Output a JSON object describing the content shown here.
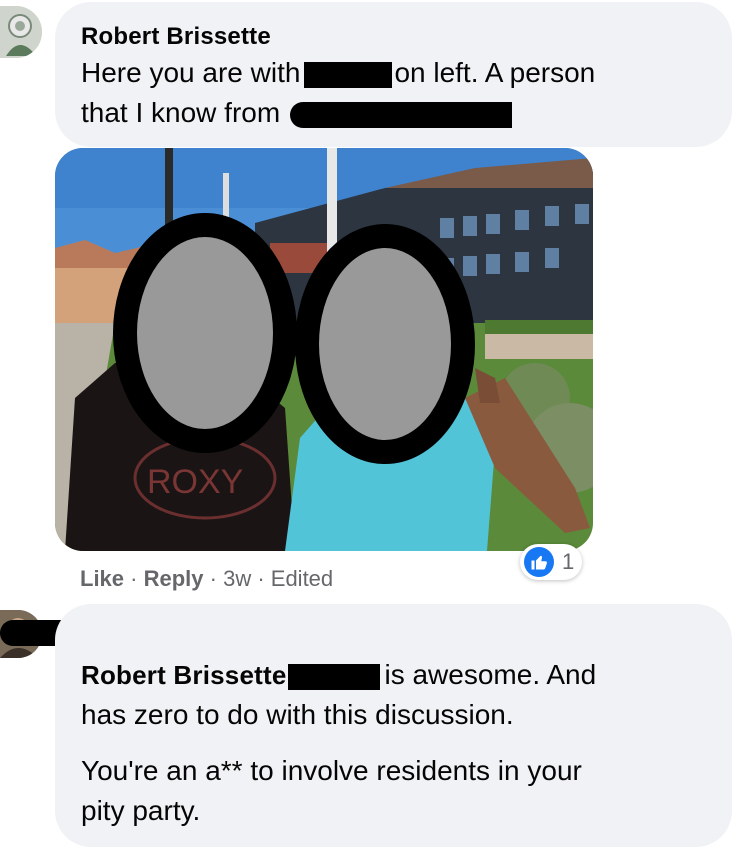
{
  "comment1": {
    "author": "Robert Brissette",
    "line1_before": "Here you are with",
    "line1_after": "on left. A person",
    "line2_before": "that I know from",
    "photo": {
      "shirt_text": "ROXY"
    },
    "actions": {
      "like": "Like",
      "sep1": " · ",
      "reply": "Reply",
      "sep2": " · ",
      "time": "3w",
      "sep3": " · ",
      "edited": "Edited"
    },
    "reaction_count": "1"
  },
  "comment2": {
    "author": "Robert Brissette",
    "line1_after": "is awesome. And",
    "line2": "has zero to do with this discussion.",
    "para2_line1": "You're an a** to involve residents in your",
    "para2_line2": "pity party."
  },
  "colors": {
    "bubble": "#f0f2f5",
    "meta_gray": "#65676b",
    "like_blue": "#1877f2"
  }
}
